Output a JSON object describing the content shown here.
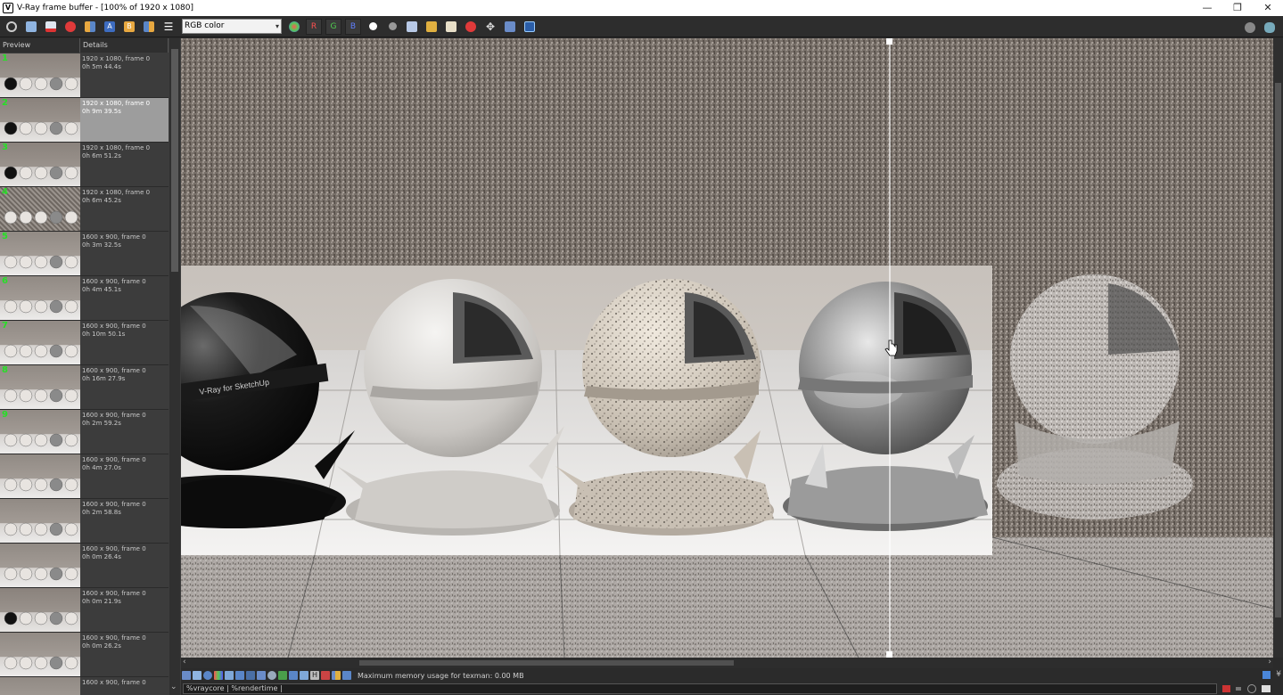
{
  "window": {
    "title": "V-Ray frame buffer - [100% of 1920 x 1080]",
    "app_icon": "vray-icon",
    "controls": [
      "minimize-icon",
      "restore-icon",
      "close-icon"
    ]
  },
  "toolbar": {
    "channel_value": "RGB color",
    "channels": [
      "R",
      "G",
      "B"
    ],
    "left_icons": [
      "power-icon",
      "save-icon",
      "save-all-icon",
      "clear-icon",
      "compare-ab-icon",
      "set-a-icon",
      "set-b-icon",
      "swap-ab-icon",
      "history-menu-icon"
    ],
    "right_icons": [
      "color-correction-icon",
      "mono-icon",
      "alpha-icon",
      "save-image-icon",
      "load-image-icon",
      "clear-image-icon",
      "stop-render-icon",
      "track-mouse-icon",
      "region-render-icon",
      "lens-effects-icon"
    ],
    "far_right_icons": [
      "sphere-icon",
      "teapot-icon"
    ]
  },
  "history": {
    "col_preview": "Preview",
    "col_details": "Details",
    "items": [
      {
        "num": "1",
        "line1": "1920 x 1080, frame 0",
        "line2": "0h 5m 44.4s",
        "selected": false,
        "style": "dark"
      },
      {
        "num": "2",
        "line1": "1920 x 1080, frame 0",
        "line2": "0h 9m 39.5s",
        "selected": true,
        "style": "dark"
      },
      {
        "num": "3",
        "line1": "1920 x 1080, frame 0",
        "line2": "0h 6m 51.2s",
        "selected": false,
        "style": "dark"
      },
      {
        "num": "4",
        "line1": "1920 x 1080, frame 0",
        "line2": "0h 6m 45.2s",
        "selected": false,
        "style": "noise"
      },
      {
        "num": "5",
        "line1": "1600 x 900, frame 0",
        "line2": "0h 3m 32.5s",
        "selected": false,
        "style": "light"
      },
      {
        "num": "6",
        "line1": "1600 x 900, frame 0",
        "line2": "0h 4m 45.1s",
        "selected": false,
        "style": "light"
      },
      {
        "num": "7",
        "line1": "1600 x 900, frame 0",
        "line2": "0h 10m 50.1s",
        "selected": false,
        "style": "light"
      },
      {
        "num": "8",
        "line1": "1600 x 900, frame 0",
        "line2": "0h 16m 27.9s",
        "selected": false,
        "style": "light"
      },
      {
        "num": "9",
        "line1": "1600 x 900, frame 0",
        "line2": "0h 2m 59.2s",
        "selected": false,
        "style": "light"
      },
      {
        "num": "",
        "line1": "1600 x 900, frame 0",
        "line2": "0h 4m 27.0s",
        "selected": false,
        "style": "light"
      },
      {
        "num": "",
        "line1": "1600 x 900, frame 0",
        "line2": "0h 2m 58.8s",
        "selected": false,
        "style": "light"
      },
      {
        "num": "",
        "line1": "1600 x 900, frame 0",
        "line2": "0h 0m 26.4s",
        "selected": false,
        "style": "light"
      },
      {
        "num": "",
        "line1": "1600 x 900, frame 0",
        "line2": "0h 0m 21.9s",
        "selected": false,
        "style": "dark"
      },
      {
        "num": "",
        "line1": "1600 x 900, frame 0",
        "line2": "0h 0m 26.2s",
        "selected": false,
        "style": "light"
      },
      {
        "num": "",
        "line1": "1600 x 900, frame 0",
        "line2": "",
        "selected": false,
        "style": "light"
      }
    ]
  },
  "render": {
    "sphere_label_1": "V-Ray for SketchUp",
    "sphere_label_2": "etchUp",
    "logo_text": "V-Ray for SketchUp"
  },
  "status": {
    "message": "Maximum memory usage for texman: 0.00 MB",
    "stamp_text": "%vraycore | %rendertime |"
  },
  "colors": {
    "accent_green": "#26e026",
    "selected_row": "#9d9d9d",
    "panel_bg": "#3c3c3c"
  }
}
